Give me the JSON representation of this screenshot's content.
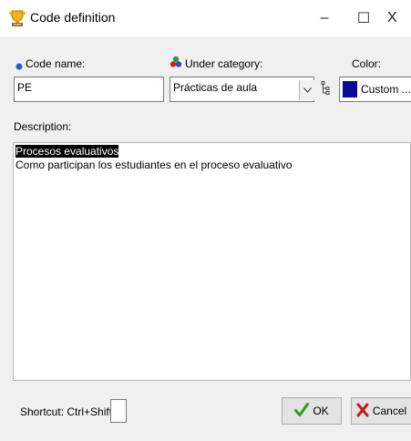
{
  "window": {
    "title": "Code definition",
    "minimize_glyph": "–",
    "maximize_glyph": "☐",
    "close_glyph": "X",
    "icon": "trophy-icon"
  },
  "form": {
    "code_name_label": "Code name:",
    "code_name_value": "PE",
    "under_category_label": "Under category:",
    "under_category_value": "Prácticas de aula",
    "color_label": "Color:",
    "color_value": "Custom ...",
    "color_swatch": "#0a0a9c",
    "description_label": "Description:",
    "description_lines": [
      "Procesos evaluativos",
      "Como participan los estudiantes en el proceso evaluativo"
    ],
    "shortcut_label": "Shortcut: Ctrl+Shift+",
    "shortcut_value": ""
  },
  "buttons": {
    "ok_label": "OK",
    "cancel_label": "Cancel"
  },
  "colors": {
    "code_name_bullet": "#1560d8",
    "ok_check": "#2e9e1f",
    "cancel_x": "#c81818"
  }
}
